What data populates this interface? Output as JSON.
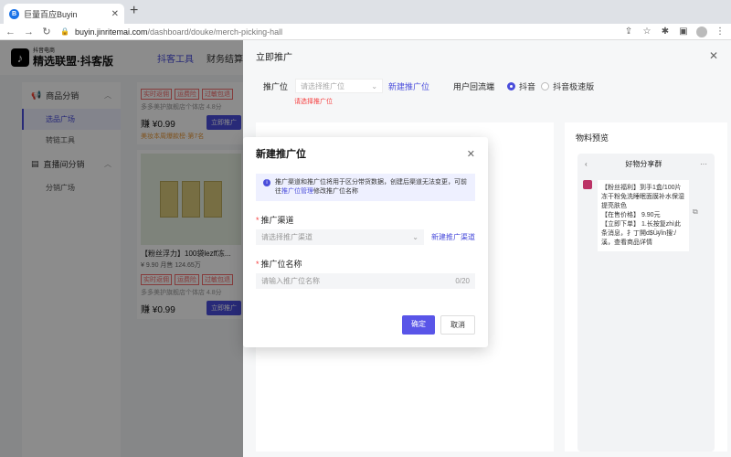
{
  "browser": {
    "tab_title": "巨量百应Buyin",
    "url_host": "buyin.jinritemai.com",
    "url_path": "/dashboard/douke/merch-picking-hall"
  },
  "app": {
    "logo_small": "抖音电商",
    "logo_title": "精选联盟·抖客版",
    "nav": [
      "抖客工具",
      "财务结算"
    ],
    "sidebar": {
      "group1": "商品分销",
      "group1_items": [
        "选品广场",
        "转链工具"
      ],
      "group2": "直播间分销",
      "group2_items": [
        "分销广场"
      ]
    },
    "cards": {
      "tags": [
        "实时返佣",
        "运费险",
        "过敏包退"
      ],
      "shop_score": "多多美护旗舰店个体店 4.8分",
      "price": "赚 ¥0.99",
      "promo_label": "立即推广",
      "hot_rank": "美妆本周爆款榜·第7名",
      "product_title": "【粉丝浮力】100袋lezff冻...",
      "product_meta": "¥ 9.90   月售 124.65万",
      "shop_score2": "多多美护旗舰店个体店 4.8分",
      "price2": "赚 ¥0.99",
      "promo_label2": "立即推广"
    }
  },
  "drawer": {
    "title": "立即推广",
    "slot_label": "推广位",
    "slot_placeholder": "请选择推广位",
    "new_slot_link": "新建推广位",
    "traffic_label": "用户回流端",
    "radio_douyin": "抖音",
    "radio_speed": "抖音极速版",
    "error_text": "请选择推广位",
    "preview_title": "物料预览",
    "group_name": "好物分享群",
    "message": "【粉丝福利】到手1盒/100片冻干粉免洗睡眠面膜补水保湿提亮肤色\n【在售价格】 9.90元\n【立即下单】 1.长按复zhì此条消息，扌丁開d$Ü̵ÿï̈n搜:/ 溪，查看商品详情"
  },
  "modal": {
    "title": "新建推广位",
    "alert_text_1": "推广渠道和推广位将用于区分带货数据，创建后渠道无法变更，可前往",
    "alert_link": "推广位管理",
    "alert_text_2": "修改推广位名称",
    "channel_label": "推广渠道",
    "channel_placeholder": "请选择推广渠道",
    "new_channel_link": "新建推广渠道",
    "name_label": "推广位名称",
    "name_placeholder": "请输入推广位名称",
    "name_count": "0/20",
    "ok": "确定",
    "cancel": "取消"
  }
}
